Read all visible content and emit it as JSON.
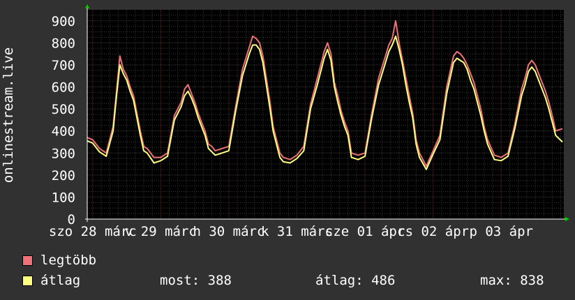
{
  "chart_data": {
    "type": "line",
    "ylabel": "onlinestream.live",
    "ylim": [
      0,
      950
    ],
    "yticks": [
      0,
      100,
      200,
      300,
      400,
      500,
      600,
      700,
      800,
      900
    ],
    "x_tick_labels": [
      "szo 28 márc",
      "v 29 márc",
      "h 30 márc",
      "k 31 márc",
      "sze 01 ápr",
      "cs 02 ápr",
      "p 03 ápr"
    ],
    "x_tick_positions_days": [
      0,
      1,
      2,
      3,
      4,
      5,
      6
    ],
    "x_range_days": [
      -0.08,
      6.92
    ],
    "grid": true,
    "legend_placement": "bottom-left",
    "colors": {
      "max": "#f07178",
      "avg": "#ffff80",
      "background": "#000000",
      "grid_major": "#5a2a2a",
      "grid_minor": "#3a3a3a",
      "axis": "#ffffff",
      "arrow": "#00cc00"
    },
    "series": [
      {
        "name": "legtöbb",
        "x": [
          -0.08,
          0.0,
          0.1,
          0.2,
          0.3,
          0.35,
          0.4,
          0.45,
          0.5,
          0.55,
          0.6,
          0.65,
          0.7,
          0.75,
          0.8,
          0.9,
          1.0,
          1.1,
          1.2,
          1.3,
          1.35,
          1.4,
          1.45,
          1.5,
          1.55,
          1.6,
          1.65,
          1.7,
          1.75,
          1.8,
          1.9,
          2.0,
          2.1,
          2.2,
          2.3,
          2.35,
          2.4,
          2.45,
          2.5,
          2.55,
          2.6,
          2.65,
          2.7,
          2.75,
          2.8,
          2.9,
          3.0,
          3.1,
          3.2,
          3.3,
          3.35,
          3.4,
          3.45,
          3.5,
          3.55,
          3.6,
          3.65,
          3.7,
          3.75,
          3.8,
          3.9,
          4.0,
          4.1,
          4.2,
          4.3,
          4.35,
          4.4,
          4.45,
          4.5,
          4.55,
          4.6,
          4.65,
          4.7,
          4.75,
          4.8,
          4.9,
          5.0,
          5.1,
          5.2,
          5.3,
          5.35,
          5.4,
          5.45,
          5.5,
          5.55,
          5.6,
          5.65,
          5.7,
          5.75,
          5.8,
          5.9,
          6.0,
          6.1,
          6.2,
          6.3,
          6.35,
          6.4,
          6.45,
          6.5,
          6.55,
          6.6,
          6.65,
          6.7,
          6.75,
          6.8,
          6.9
        ],
        "values": [
          370,
          360,
          320,
          300,
          420,
          580,
          740,
          680,
          650,
          600,
          560,
          480,
          400,
          330,
          320,
          280,
          280,
          300,
          470,
          530,
          590,
          610,
          570,
          530,
          480,
          440,
          400,
          340,
          330,
          310,
          320,
          330,
          510,
          680,
          780,
          830,
          820,
          800,
          740,
          640,
          540,
          420,
          360,
          300,
          280,
          270,
          290,
          330,
          520,
          640,
          700,
          760,
          800,
          750,
          620,
          560,
          490,
          440,
          400,
          300,
          290,
          300,
          480,
          640,
          740,
          790,
          820,
          900,
          800,
          720,
          640,
          560,
          480,
          360,
          300,
          240,
          310,
          380,
          600,
          740,
          760,
          750,
          730,
          700,
          660,
          620,
          560,
          500,
          420,
          360,
          290,
          280,
          300,
          430,
          590,
          640,
          700,
          720,
          700,
          660,
          620,
          580,
          530,
          470,
          400,
          410
        ]
      },
      {
        "name": "átlag",
        "x": [
          -0.08,
          0.0,
          0.1,
          0.2,
          0.3,
          0.35,
          0.4,
          0.45,
          0.5,
          0.55,
          0.6,
          0.65,
          0.7,
          0.75,
          0.8,
          0.9,
          1.0,
          1.1,
          1.2,
          1.3,
          1.35,
          1.4,
          1.45,
          1.5,
          1.55,
          1.6,
          1.65,
          1.7,
          1.75,
          1.8,
          1.9,
          2.0,
          2.1,
          2.2,
          2.3,
          2.35,
          2.4,
          2.45,
          2.5,
          2.55,
          2.6,
          2.65,
          2.7,
          2.75,
          2.8,
          2.9,
          3.0,
          3.1,
          3.2,
          3.3,
          3.35,
          3.4,
          3.45,
          3.5,
          3.55,
          3.6,
          3.65,
          3.7,
          3.75,
          3.8,
          3.9,
          4.0,
          4.1,
          4.2,
          4.3,
          4.35,
          4.4,
          4.45,
          4.5,
          4.55,
          4.6,
          4.65,
          4.7,
          4.75,
          4.8,
          4.9,
          5.0,
          5.1,
          5.2,
          5.3,
          5.35,
          5.4,
          5.45,
          5.5,
          5.55,
          5.6,
          5.65,
          5.7,
          5.75,
          5.8,
          5.9,
          6.0,
          6.1,
          6.2,
          6.3,
          6.35,
          6.4,
          6.45,
          6.5,
          6.55,
          6.6,
          6.65,
          6.7,
          6.75,
          6.8,
          6.9
        ],
        "values": [
          355,
          345,
          305,
          285,
          400,
          560,
          700,
          660,
          630,
          580,
          540,
          460,
          380,
          310,
          300,
          255,
          265,
          285,
          450,
          510,
          560,
          580,
          550,
          510,
          460,
          420,
          380,
          320,
          305,
          290,
          300,
          310,
          490,
          650,
          750,
          790,
          790,
          770,
          710,
          610,
          510,
          400,
          340,
          280,
          260,
          255,
          275,
          310,
          500,
          610,
          670,
          730,
          770,
          720,
          600,
          530,
          470,
          420,
          380,
          280,
          270,
          285,
          460,
          610,
          710,
          760,
          790,
          830,
          770,
          700,
          610,
          530,
          460,
          340,
          280,
          225,
          295,
          360,
          570,
          710,
          730,
          720,
          710,
          680,
          630,
          590,
          530,
          470,
          400,
          340,
          270,
          265,
          285,
          410,
          560,
          610,
          670,
          690,
          670,
          630,
          590,
          550,
          500,
          440,
          380,
          350
        ]
      }
    ]
  },
  "legend": {
    "max_label": "legtöbb",
    "avg_label": "átlag"
  },
  "stats": {
    "most": "most: 388",
    "atlag": "átlag: 486",
    "max": "max: 838"
  }
}
